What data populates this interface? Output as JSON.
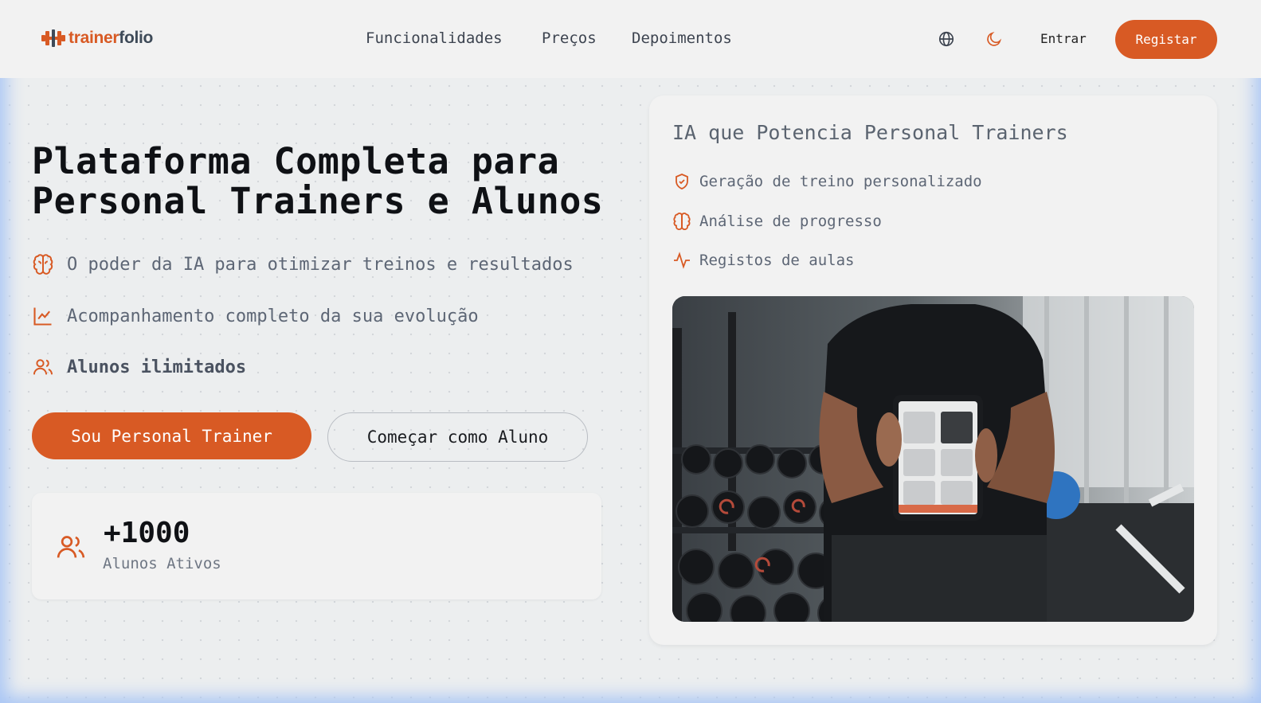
{
  "brand": {
    "name_part1": "trainer",
    "name_part2": "folio",
    "accent": "#d85a24"
  },
  "nav": {
    "items": [
      "Funcionalidades",
      "Preços",
      "Depoimentos"
    ]
  },
  "header": {
    "language_icon": "globe-icon",
    "theme_icon": "moon-icon",
    "login_label": "Entrar",
    "register_label": "Registar"
  },
  "hero": {
    "title_line1": "Plataforma Completa para",
    "title_line2": "Personal Trainers e Alunos",
    "features": [
      {
        "icon": "brain-icon",
        "text": "O poder da IA para otimizar treinos e resultados"
      },
      {
        "icon": "line-chart-icon",
        "text": "Acompanhamento completo da sua evolução"
      },
      {
        "icon": "users-icon",
        "text": "Alunos ilimitados"
      }
    ],
    "primary_cta": "Sou Personal Trainer",
    "secondary_cta": "Começar como Aluno"
  },
  "stats": {
    "icon": "users-icon",
    "value": "+1000",
    "label": "Alunos Ativos"
  },
  "ai_card": {
    "title": "IA que Potencia Personal Trainers",
    "features": [
      {
        "icon": "shield-check-icon",
        "text": "Geração de treino personalizado"
      },
      {
        "icon": "brain-icon",
        "text": "Análise de progresso"
      },
      {
        "icon": "activity-icon",
        "text": "Registos de aulas"
      }
    ],
    "image_alt": "trainer-holding-tablet-in-gym-photo"
  }
}
